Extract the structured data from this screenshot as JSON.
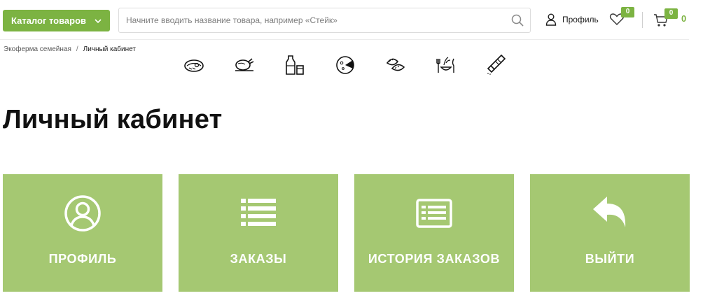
{
  "header": {
    "catalog_label": "Каталог товаров",
    "search_placeholder": "Начните вводить название товара, например «Стейк»",
    "profile_label": "Профиль",
    "favorites_count": "0",
    "cart_count": "0",
    "cart_total": "0"
  },
  "breadcrumb": {
    "home": "Экоферма семейная",
    "separator": "/",
    "current": "Личный кабинет"
  },
  "category_icons": [
    "steak-icon",
    "chicken-icon",
    "milk-icon",
    "cheese-icon",
    "dumplings-icon",
    "restaurant-icon",
    "spices-icon"
  ],
  "page": {
    "title": "Личный кабинет"
  },
  "tiles": [
    {
      "label": "ПРОФИЛЬ",
      "icon": "user-circle-icon"
    },
    {
      "label": "ЗАКАЗЫ",
      "icon": "list-icon"
    },
    {
      "label": "ИСТОРИЯ ЗАКАЗОВ",
      "icon": "order-history-icon"
    },
    {
      "label": "ВЫЙТИ",
      "icon": "reply-arrow-icon"
    }
  ],
  "colors": {
    "accent": "#7cb342",
    "tile_bg": "#a5c872",
    "text": "#1b1b1b"
  }
}
